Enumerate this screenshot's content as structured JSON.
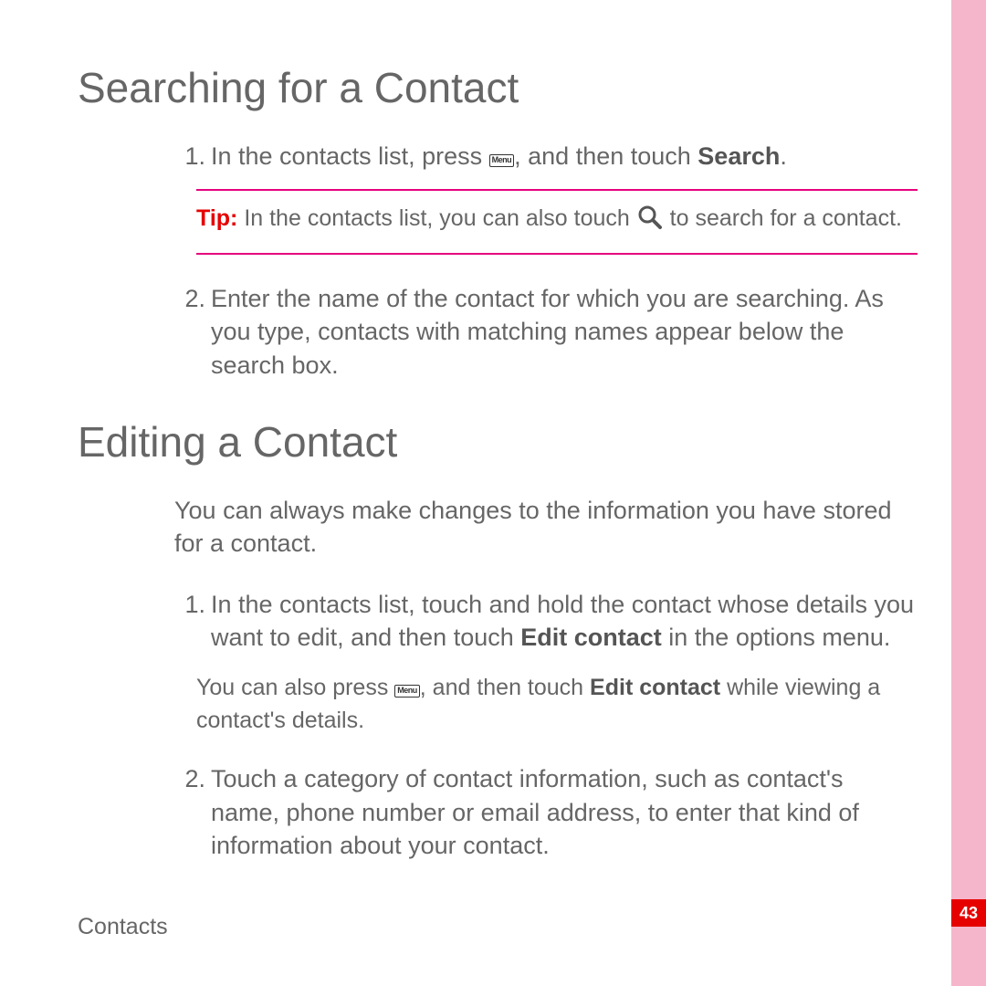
{
  "heading1": "Searching for a Contact",
  "search": {
    "step1_pre": "In the contacts list, press ",
    "menu_key": "Menu",
    "step1_mid": ", and then touch ",
    "step1_bold": "Search",
    "step1_post": ".",
    "tip_label": "Tip:",
    "tip_pre": " In the contacts list, you can also touch ",
    "tip_post": " to search for a contact.",
    "step2": "Enter the name of the contact for which you are searching. As you type, contacts with matching names appear below the search box."
  },
  "heading2": "Editing a Contact",
  "edit": {
    "intro": "You can always make changes to the information you have stored for a contact.",
    "step1_pre": "In the contacts list, touch and hold the contact whose details you want to edit, and then touch ",
    "step1_bold": "Edit contact",
    "step1_post": " in the options menu.",
    "note_pre": "You can also press ",
    "note_mid": ", and then touch ",
    "note_bold": "Edit contact",
    "note_post": " while viewing a contact's details.",
    "step2": "Touch a category of contact information, such as contact's name, phone number or email address, to enter that kind of information about your contact."
  },
  "footer_section": "Contacts",
  "page_number": "43",
  "num1": "1.",
  "num2": "2."
}
